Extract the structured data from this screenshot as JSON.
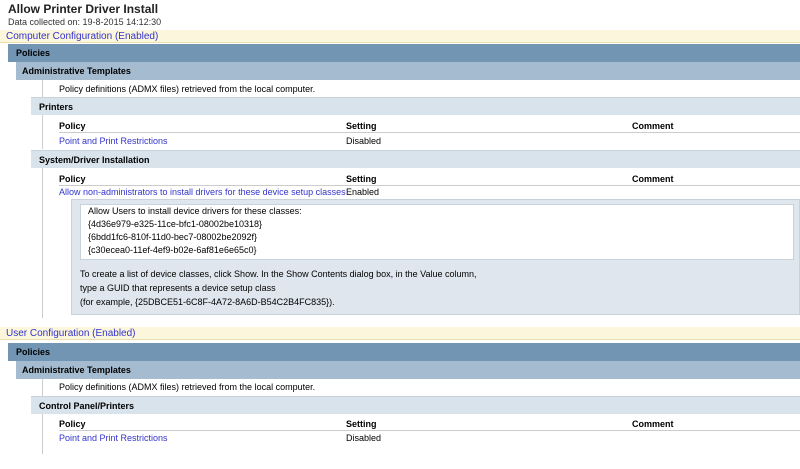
{
  "title": "Allow Printer Driver Install",
  "date": "Data collected on: 19-8-2015 14:12:30",
  "computer": {
    "header": "Computer Configuration (Enabled)",
    "policies": "Policies",
    "admin": "Administrative Templates",
    "admin_note": "Policy definitions (ADMX files) retrieved from the local computer.",
    "printers": {
      "header": "Printers",
      "cols": [
        "Policy",
        "Setting",
        "Comment"
      ],
      "row": {
        "policy": "Point and Print Restrictions",
        "setting": "Disabled"
      }
    },
    "sysdriver": {
      "header": "System/Driver Installation",
      "cols": [
        "Policy",
        "Setting",
        "Comment"
      ],
      "row": {
        "policy": "Allow non-administrators to install drivers for these device setup classes",
        "setting": "Enabled"
      },
      "detail": {
        "label": "Allow Users to install device drivers for these classes:",
        "classes": [
          "{4d36e979-e325-11ce-bfc1-08002be10318}",
          "{6bdd1fc6-810f-11d0-bec7-08002be2092f}",
          "{c30ecea0-11ef-4ef9-b02e-6af81e6e65c0}"
        ],
        "help": [
          "To create a list of device classes, click Show. In the Show Contents dialog box, in the Value column,",
          "type a GUID that represents a device setup class",
          "(for example, {25DBCE51-6C8F-4A72-8A6D-B54C2B4FC835})."
        ]
      }
    }
  },
  "user": {
    "header": "User Configuration (Enabled)",
    "policies": "Policies",
    "admin": "Administrative Templates",
    "admin_note": "Policy definitions (ADMX files) retrieved from the local computer.",
    "cp": {
      "header": "Control Panel/Printers",
      "cols": [
        "Policy",
        "Setting",
        "Comment"
      ],
      "row": {
        "policy": "Point and Print Restrictions",
        "setting": "Disabled"
      }
    }
  }
}
